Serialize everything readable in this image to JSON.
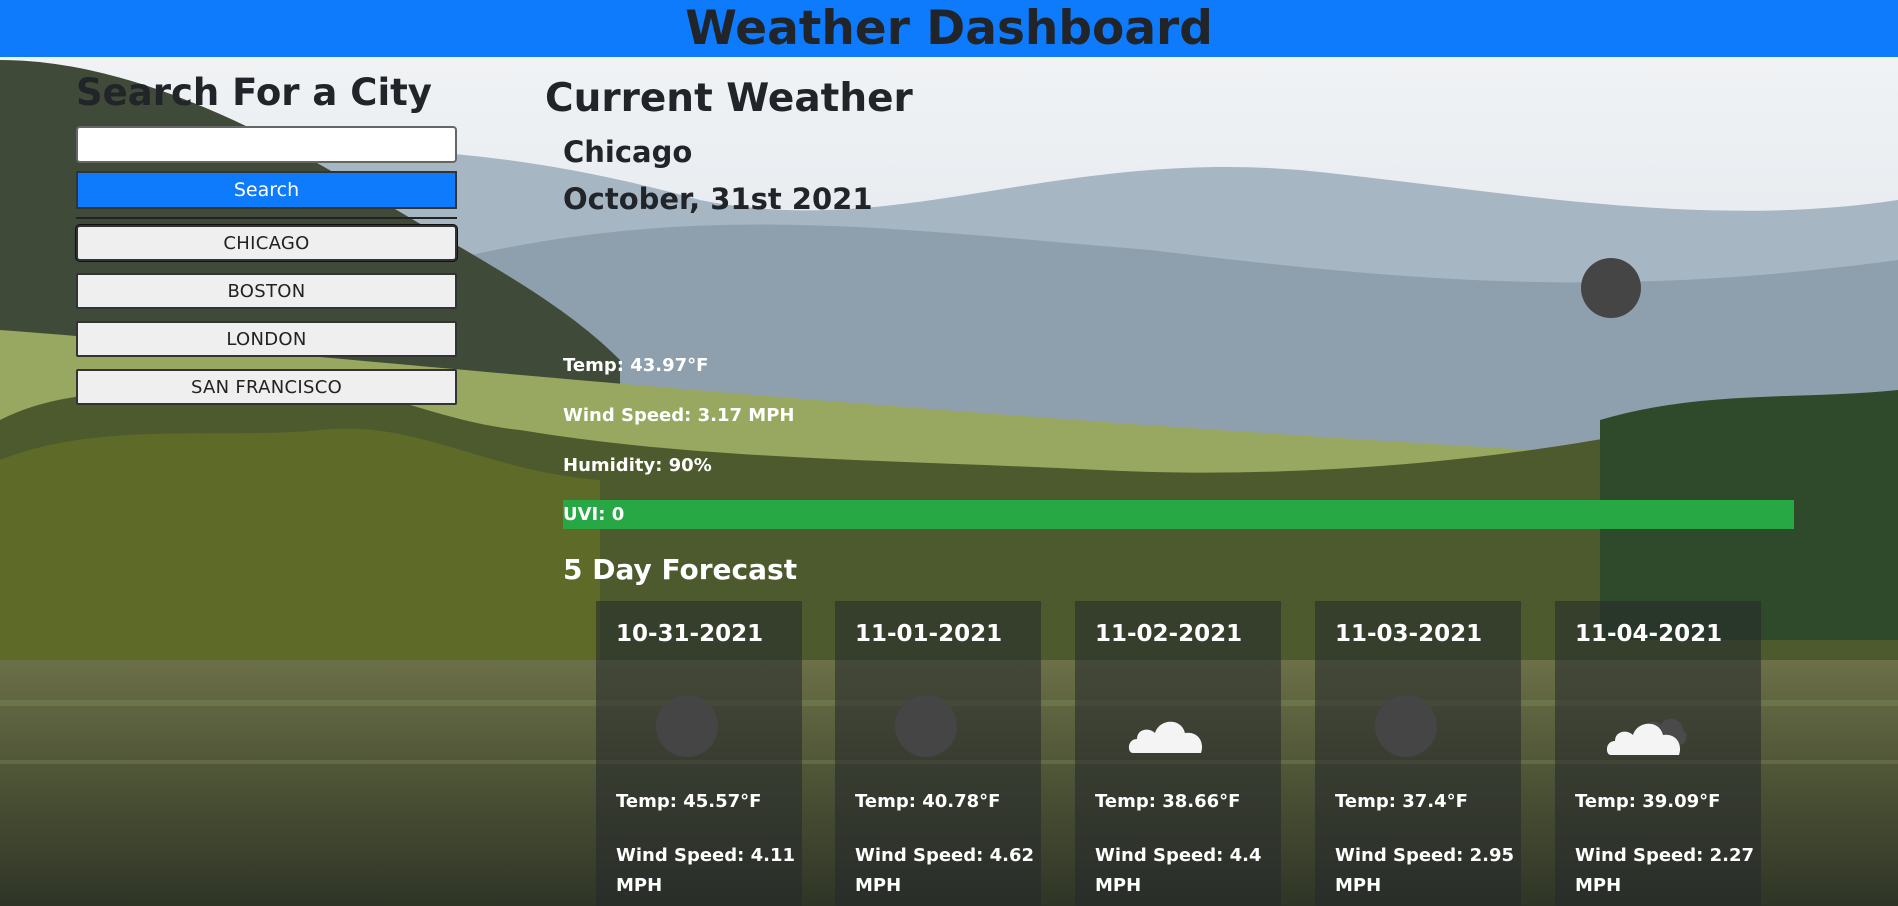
{
  "header": {
    "title": "Weather Dashboard"
  },
  "search": {
    "heading": "Search For a City",
    "input_value": "",
    "button_label": "Search"
  },
  "history": [
    {
      "label": "CHICAGO",
      "selected": true
    },
    {
      "label": "BOSTON",
      "selected": false
    },
    {
      "label": "LONDON",
      "selected": false
    },
    {
      "label": "SAN FRANCISCO",
      "selected": false
    }
  ],
  "current": {
    "heading": "Current Weather",
    "city": "Chicago",
    "date": "October, 31st 2021",
    "icon": "clear-night-icon",
    "temp": "Temp: 43.97°F",
    "wind": "Wind Speed: 3.17 MPH",
    "humidity": "Humidity: 90%",
    "uvi": "UVI: 0",
    "uvi_color": "#27a845"
  },
  "forecast": {
    "heading": "5 Day Forecast",
    "days": [
      {
        "date": "10-31-2021",
        "icon": "clear-night-icon",
        "temp": "Temp: 45.57°F",
        "wind": "Wind Speed: 4.11 MPH"
      },
      {
        "date": "11-01-2021",
        "icon": "clear-night-icon",
        "temp": "Temp: 40.78°F",
        "wind": "Wind Speed: 4.62 MPH"
      },
      {
        "date": "11-02-2021",
        "icon": "cloud-icon",
        "temp": "Temp: 38.66°F",
        "wind": "Wind Speed: 4.4 MPH"
      },
      {
        "date": "11-03-2021",
        "icon": "clear-night-icon",
        "temp": "Temp: 37.4°F",
        "wind": "Wind Speed: 2.95 MPH"
      },
      {
        "date": "11-04-2021",
        "icon": "broken-clouds-icon",
        "temp": "Temp: 39.09°F",
        "wind": "Wind Speed: 2.27 MPH"
      }
    ]
  },
  "colors": {
    "header_bg": "#0d7bfc",
    "search_button_bg": "#0d7bfc",
    "uvi_low": "#27a845"
  }
}
